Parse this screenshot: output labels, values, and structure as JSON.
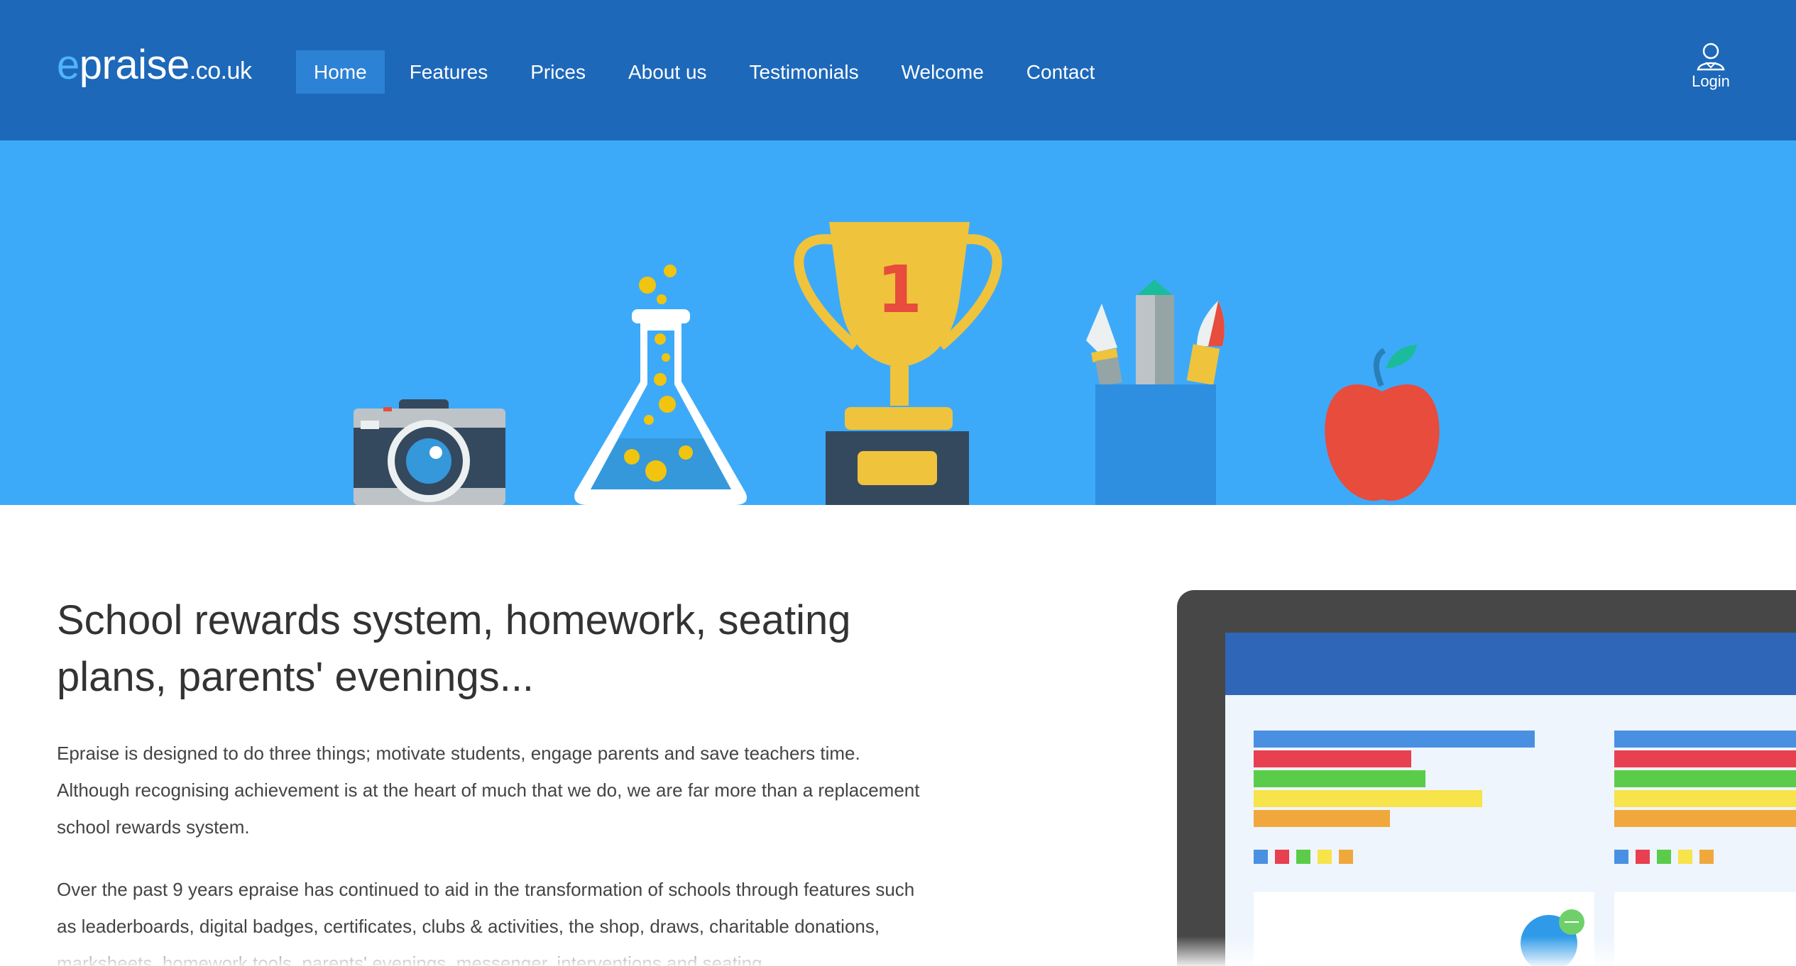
{
  "brand": {
    "logo_e": "e",
    "logo_rest": "praise",
    "logo_tld": ".co.uk"
  },
  "nav": {
    "items": [
      {
        "label": "Home",
        "active": true
      },
      {
        "label": "Features"
      },
      {
        "label": "Prices"
      },
      {
        "label": "About us"
      },
      {
        "label": "Testimonials"
      },
      {
        "label": "Welcome"
      },
      {
        "label": "Contact"
      }
    ],
    "login_label": "Login",
    "login_icon": "user-icon"
  },
  "hero": {
    "icons": [
      "camera-icon",
      "flask-icon",
      "trophy-icon",
      "pen-pot-icon",
      "apple-icon"
    ],
    "trophy_label": "1"
  },
  "main": {
    "headline": "School rewards system, homework, seating plans, parents' evenings...",
    "paragraph1": "Epraise is designed to do three things; motivate students, engage parents and save teachers time. Although recognising achievement is at the heart of much that we do, we are far more than a replacement school rewards system.",
    "paragraph2": "Over the past 9 years epraise has continued to aid in the transformation of schools through features such as leaderboards, digital badges, certificates, clubs & activities, the shop, draws, charitable donations, marksheets, homework tools, parents' evenings, messenger, interventions and seating"
  },
  "colors": {
    "navbar": "#1d68b9",
    "hero": "#3daaf9",
    "active_nav": "#2c82d4",
    "logo_accent": "#4fb3ff"
  }
}
